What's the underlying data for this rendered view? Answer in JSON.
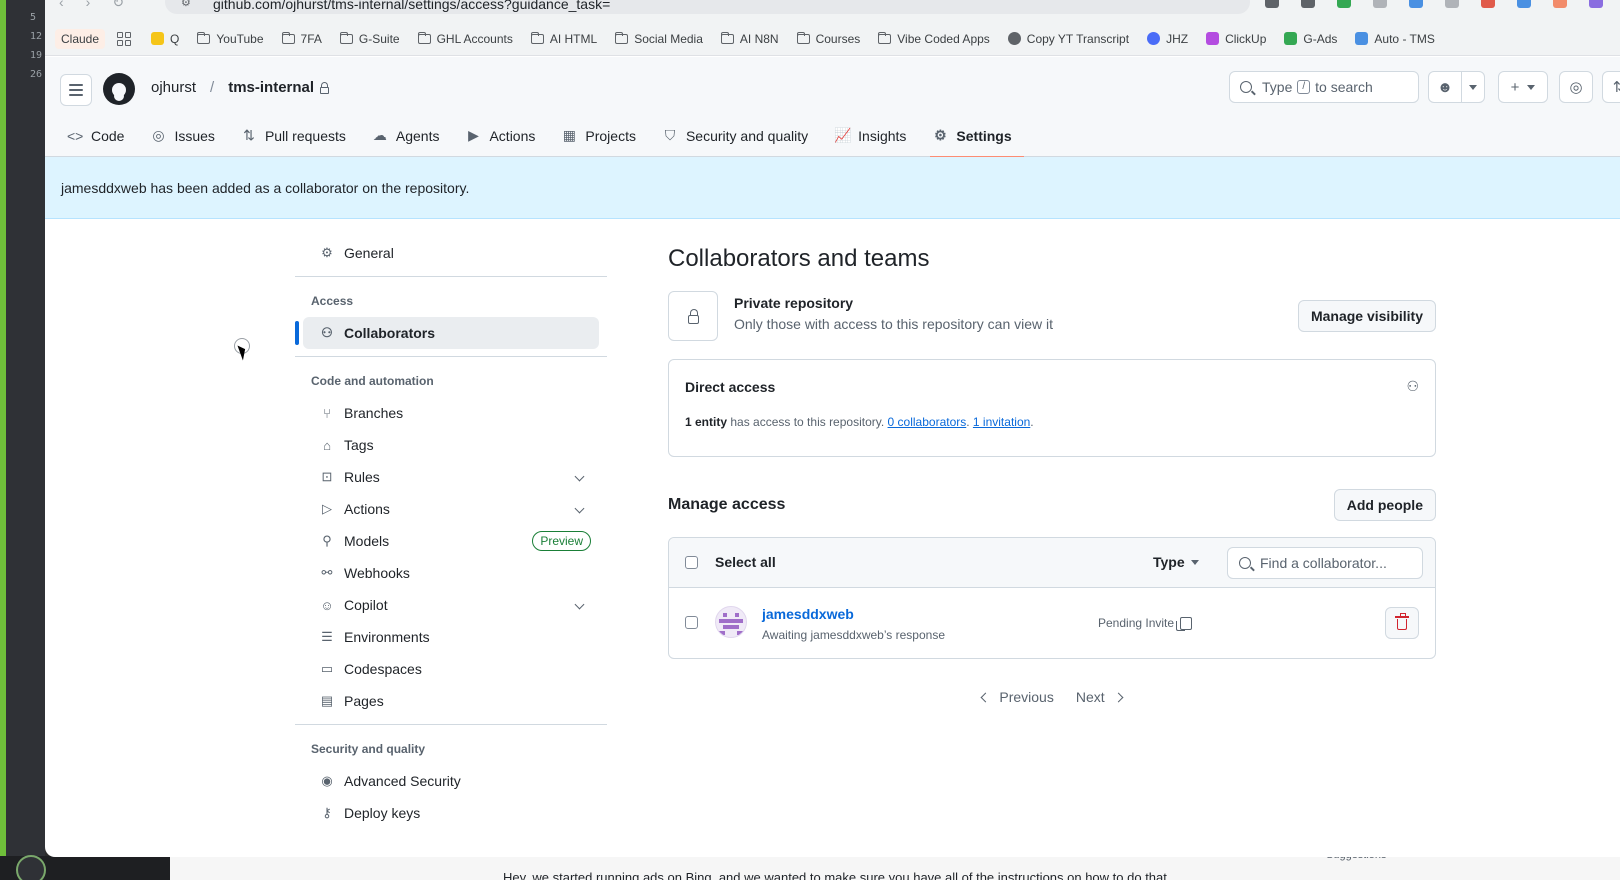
{
  "browser": {
    "url": "github.com/ojhurst/tms-internal/settings/access?guidance_task=",
    "bookmarks": [
      {
        "label": "Claude",
        "type": "chip"
      },
      {
        "label": "Q",
        "type": "icon",
        "color": "#f5c518"
      },
      {
        "label": "YouTube",
        "type": "folder"
      },
      {
        "label": "7FA",
        "type": "folder"
      },
      {
        "label": "G-Suite",
        "type": "folder"
      },
      {
        "label": "GHL Accounts",
        "type": "folder"
      },
      {
        "label": "AI HTML",
        "type": "folder"
      },
      {
        "label": "Social Media",
        "type": "folder"
      },
      {
        "label": "AI N8N",
        "type": "folder"
      },
      {
        "label": "Courses",
        "type": "folder"
      },
      {
        "label": "Vibe Coded Apps",
        "type": "folder"
      },
      {
        "label": "Copy YT Transcript",
        "type": "icon",
        "color": "#5f6368"
      },
      {
        "label": "JHZ",
        "type": "icon",
        "color": "#4a6cf7"
      },
      {
        "label": "ClickUp",
        "type": "icon",
        "color": "#b44ce0"
      },
      {
        "label": "G-Ads",
        "type": "icon",
        "color": "#34a853"
      },
      {
        "label": "Auto - TMS",
        "type": "icon",
        "color": "#4a90e2"
      }
    ]
  },
  "left_gutter": [
    "5",
    "12",
    "19",
    "26"
  ],
  "header": {
    "owner": "ojhurst",
    "separator": "/",
    "repo": "tms-internal",
    "search_prefix": "Type",
    "search_key": "/",
    "search_suffix": "to search"
  },
  "tabs": [
    {
      "label": "Code",
      "icon": "code-icon",
      "glyph": "<>"
    },
    {
      "label": "Issues",
      "icon": "issue-icon",
      "glyph": "◎"
    },
    {
      "label": "Pull requests",
      "icon": "pull-request-icon",
      "glyph": "⇅"
    },
    {
      "label": "Agents",
      "icon": "agents-icon",
      "glyph": "☁"
    },
    {
      "label": "Actions",
      "icon": "actions-icon",
      "glyph": "▶"
    },
    {
      "label": "Projects",
      "icon": "projects-icon",
      "glyph": "▦"
    },
    {
      "label": "Security and quality",
      "icon": "shield-icon",
      "glyph": "⛉"
    },
    {
      "label": "Insights",
      "icon": "graph-icon",
      "glyph": "📈"
    },
    {
      "label": "Settings",
      "icon": "gear-icon",
      "glyph": "⚙",
      "selected": true
    }
  ],
  "flash": {
    "message": "jamesddxweb has been added as a collaborator on the repository."
  },
  "sidenav": {
    "general": "General",
    "access_heading": "Access",
    "collaborators": "Collaborators",
    "code_heading": "Code and automation",
    "code_items": [
      {
        "label": "Branches",
        "icon": "branch-icon",
        "glyph": "⑂"
      },
      {
        "label": "Tags",
        "icon": "tag-icon",
        "glyph": "⌂"
      },
      {
        "label": "Rules",
        "icon": "rules-icon",
        "glyph": "⊡",
        "expandable": true
      },
      {
        "label": "Actions",
        "icon": "actions-icon",
        "glyph": "▷",
        "expandable": true
      },
      {
        "label": "Models",
        "icon": "models-icon",
        "glyph": "⚲",
        "badge": "Preview"
      },
      {
        "label": "Webhooks",
        "icon": "webhook-icon",
        "glyph": "⚯"
      },
      {
        "label": "Copilot",
        "icon": "copilot-icon",
        "glyph": "☺",
        "expandable": true
      },
      {
        "label": "Environments",
        "icon": "environments-icon",
        "glyph": "☰"
      },
      {
        "label": "Codespaces",
        "icon": "codespaces-icon",
        "glyph": "▭"
      },
      {
        "label": "Pages",
        "icon": "pages-icon",
        "glyph": "▤"
      }
    ],
    "security_heading": "Security and quality",
    "security_items": [
      {
        "label": "Advanced Security",
        "icon": "codescan-icon",
        "glyph": "◉"
      },
      {
        "label": "Deploy keys",
        "icon": "key-icon",
        "glyph": "⚷"
      }
    ]
  },
  "main": {
    "title": "Collaborators and teams",
    "visibility": {
      "title": "Private repository",
      "description": "Only those with access to this repository can view it",
      "button": "Manage visibility"
    },
    "direct_access": {
      "title": "Direct access",
      "entity_count": "1 entity",
      "text": " has access to this repository. ",
      "collaborators_link": "0 collaborators",
      "sep": ". ",
      "invitation_link": "1 invitation",
      "end": "."
    },
    "manage": {
      "title": "Manage access",
      "add_button": "Add people",
      "select_all": "Select all",
      "type_filter": "Type",
      "find_placeholder": "Find a collaborator..."
    },
    "rows": [
      {
        "username": "jamesddxweb",
        "subtext": "Awaiting jamesddxweb’s response",
        "status": "Pending Invite"
      }
    ],
    "pager": {
      "previous": "Previous",
      "next": "Next"
    }
  },
  "background": {
    "bottom_text": "Hey, we started running ads on Bing, and we wanted to make sure you have all of the instructions on how to do that",
    "suggestions": "Suggestions"
  }
}
